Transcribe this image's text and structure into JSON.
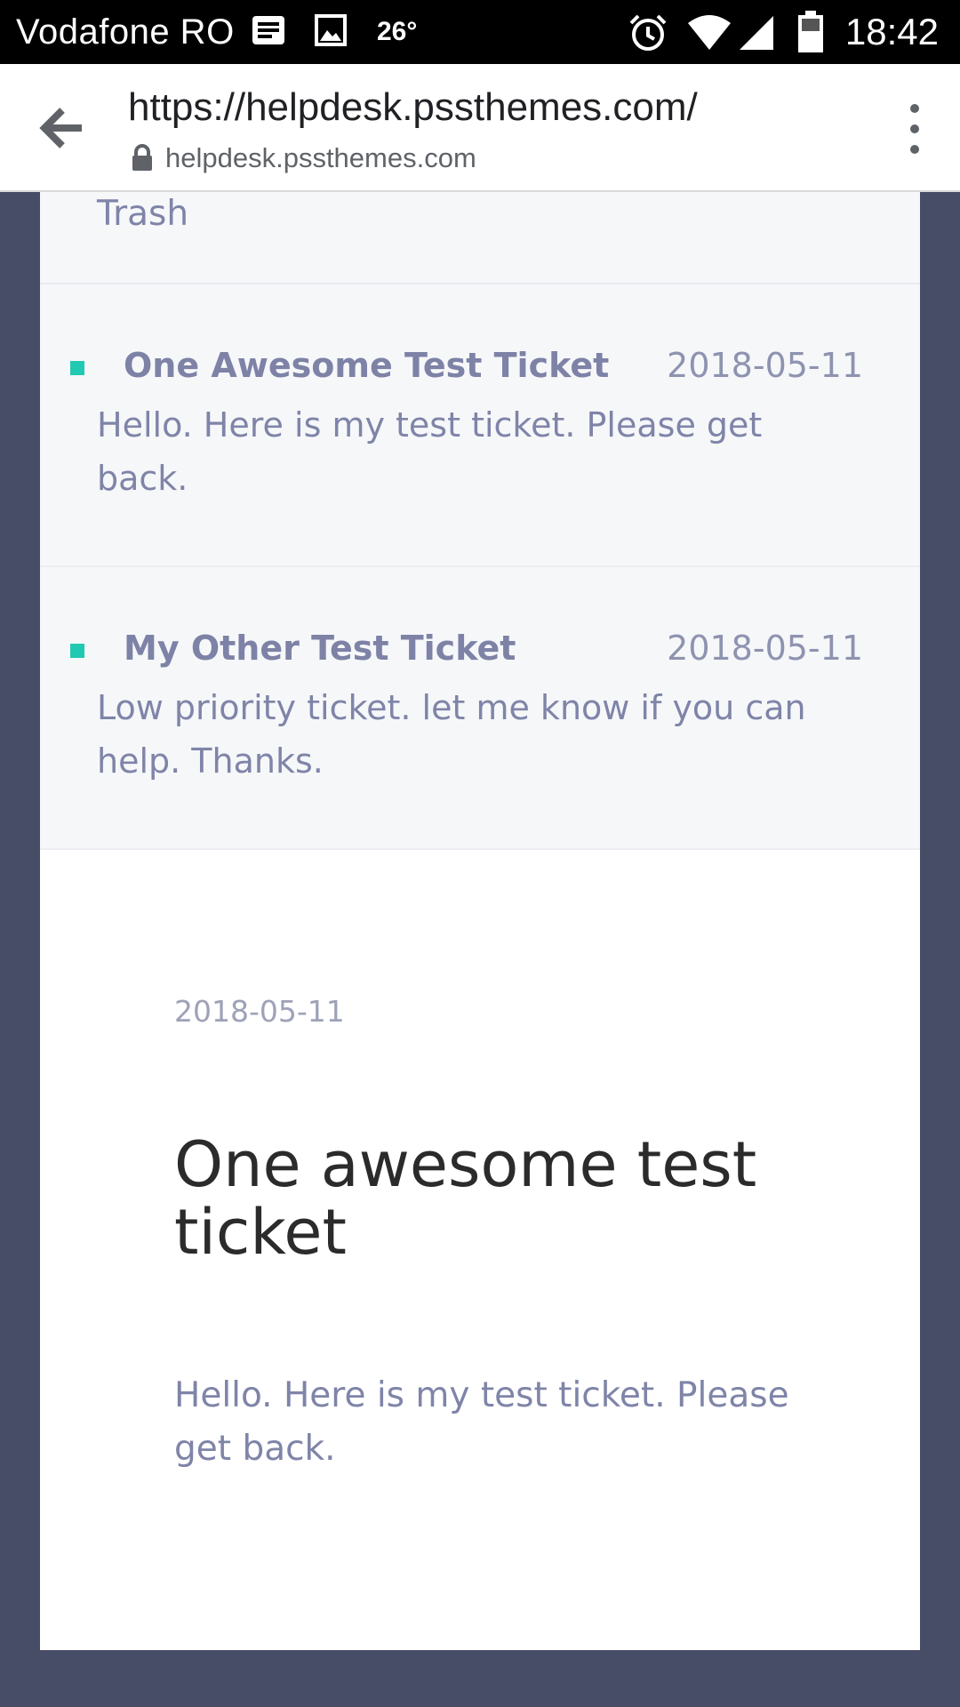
{
  "status_bar": {
    "carrier": "Vodafone RO",
    "temperature": "26°",
    "time": "18:42",
    "icons": [
      "message-icon",
      "image-icon",
      "alarm-icon",
      "wifi-icon",
      "signal-icon",
      "battery-icon"
    ]
  },
  "toolbar": {
    "url": "https://helpdesk.pssthemes.com/",
    "domain": "helpdesk.pssthemes.com",
    "icons": [
      "back-arrow-icon",
      "lock-icon",
      "overflow-menu-icon"
    ]
  },
  "sidebar_tail": {
    "trash_label": "Trash"
  },
  "tickets": [
    {
      "title": "One Awesome Test Ticket",
      "date": "2018-05-11",
      "excerpt": "Hello. Here is my test ticket. Please get back."
    },
    {
      "title": "My Other Test Ticket",
      "date": "2018-05-11",
      "excerpt": "Low priority ticket. let me know if you can help. Thanks."
    }
  ],
  "detail": {
    "date": "2018-05-11",
    "title": "One awesome test ticket",
    "body": "Hello. Here is my test ticket. Please get back."
  },
  "colors": {
    "page_background": "#474c67",
    "accent_bullet": "#21c9b2",
    "ticket_title": "#7d82a6",
    "list_background": "#f6f7f9"
  }
}
